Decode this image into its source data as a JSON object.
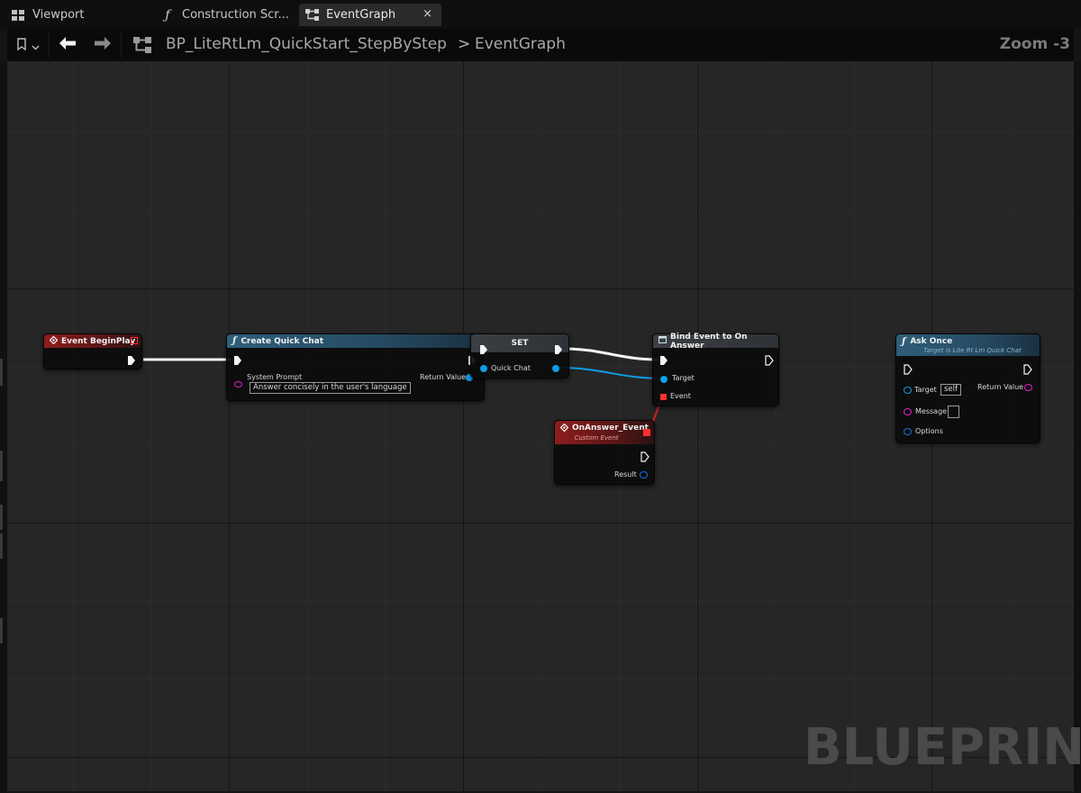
{
  "tabs": [
    {
      "label": "Viewport",
      "icon": "viewport-grid-icon",
      "active": false
    },
    {
      "label": "Construction Scr...",
      "icon": "function-icon",
      "active": false
    },
    {
      "label": "EventGraph",
      "icon": "graph-icon",
      "active": true,
      "close": "×"
    }
  ],
  "breadcrumb": {
    "blueprint": "BP_LiteRtLm_QuickStart_StepByStep",
    "separator": ">",
    "graph": "EventGraph"
  },
  "zoom": "Zoom -3",
  "watermark": "BLUEPRINT",
  "colors": {
    "exec": "#ffffff",
    "object_pin": "#0e9ee6",
    "string_pin": "#e21fd4",
    "delegate_pin": "#ff3030",
    "event_header": "#8e1d1d",
    "function_header": "#2f5f7a"
  },
  "nodes": {
    "begin_play": {
      "title": "Event BeginPlay"
    },
    "create_quick_chat": {
      "title": "Create Quick Chat",
      "system_prompt_label": "System Prompt",
      "system_prompt_value": "Answer concisely in the user's language",
      "return_label": "Return Value"
    },
    "set": {
      "title": "SET",
      "var_label": "Quick Chat"
    },
    "bind_event": {
      "title": "Bind Event to On Answer",
      "target_label": "Target",
      "event_label": "Event"
    },
    "on_answer": {
      "title": "OnAnswer_Event",
      "subtitle": "Custom Event",
      "result_label": "Result"
    },
    "ask_once": {
      "title": "Ask Once",
      "subtitle": "Target is Lite Rt Lm Quick Chat",
      "target_label": "Target",
      "target_value": "self",
      "message_label": "Message",
      "options_label": "Options",
      "return_label": "Return Value"
    }
  }
}
